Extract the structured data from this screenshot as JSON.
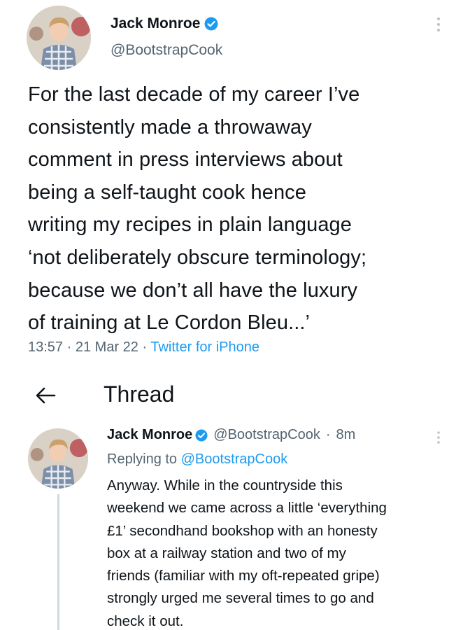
{
  "main_tweet": {
    "author_name": "Jack Monroe",
    "author_handle": "@BootstrapCook",
    "verified_icon": "verified-badge-icon",
    "text_lines": [
      "For the last decade of my career I’ve",
      "consistently made a throwaway",
      "comment in press interviews about",
      "being a self-taught cook hence",
      "writing my recipes in plain language",
      "‘not deliberately obscure terminology;",
      "because we don’t all have the luxury",
      "of training at Le Cordon Bleu...’"
    ],
    "time": "13:57",
    "separator": "·",
    "date": "21 Mar 22",
    "source": "Twitter for iPhone"
  },
  "thread_bar": {
    "back_icon": "back-arrow-icon",
    "title": "Thread"
  },
  "reply_tweet": {
    "author_name": "Jack Monroe",
    "author_handle": "@BootstrapCook",
    "separator": "·",
    "age": "8m",
    "replying_prefix": "Replying to",
    "replying_to": "@BootstrapCook",
    "text_lines": [
      "Anyway. While in the countryside this",
      "weekend we came across a little ‘everything",
      "£1’ secondhand bookshop with an honesty",
      "box at a railway station and two of my",
      "friends (familiar with my oft-repeated gripe)",
      "strongly urged me several times to go and",
      "check it out."
    ]
  },
  "colors": {
    "text": "#0f1419",
    "secondary": "#536471",
    "accent": "#1d9bf0",
    "thread_line": "#cfd9de"
  }
}
